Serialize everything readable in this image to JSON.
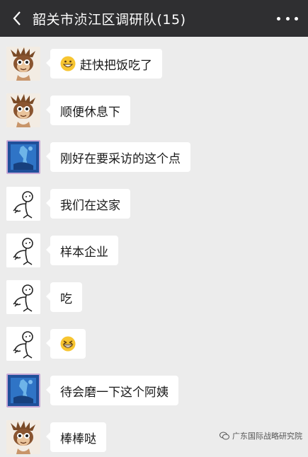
{
  "header": {
    "title": "韶关市浈江区调研队(15)"
  },
  "messages": [
    {
      "avatar": "monkey-avatar",
      "text": "赶快把饭吃了",
      "emoji": "grinning-face-emoji"
    },
    {
      "avatar": "monkey-avatar",
      "text": "顺便休息下"
    },
    {
      "avatar": "blue-painting-avatar",
      "text": "刚好在要采访的这个点"
    },
    {
      "avatar": "stick-figure-avatar",
      "text": "我们在这家"
    },
    {
      "avatar": "stick-figure-avatar",
      "text": "样本企业"
    },
    {
      "avatar": "stick-figure-avatar",
      "text": "吃"
    },
    {
      "avatar": "stick-figure-avatar",
      "text": "",
      "emoji": "grinning-squint-emoji"
    },
    {
      "avatar": "blue-painting-avatar",
      "text": "待会磨一下这个阿姨"
    },
    {
      "avatar": "monkey-avatar",
      "text": "棒棒哒"
    }
  ],
  "watermark": {
    "text": "广东国际战略研究院",
    "icon": "wechat-official-account-icon"
  },
  "colors": {
    "header_bg": "#2f2f31",
    "chat_bg": "#ececec",
    "bubble_bg": "#ffffff",
    "emoji_yellow": "#f7c531"
  }
}
